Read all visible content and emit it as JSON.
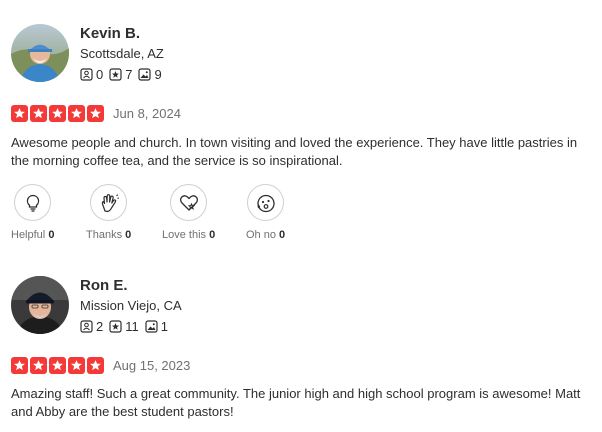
{
  "reviews": [
    {
      "name": "Kevin B.",
      "location": "Scottsdale, AZ",
      "stats": {
        "reviews": "0",
        "friends": "7",
        "photos": "9"
      },
      "rating": 5,
      "date": "Jun 8, 2024",
      "text": "Awesome people and church. In town visiting and loved the experience. They have little pastries in the morning coffee tea, and the service is so inspirational.",
      "reactions": [
        {
          "label": "Helpful",
          "count": "0",
          "icon": "lightbulb-icon"
        },
        {
          "label": "Thanks",
          "count": "0",
          "icon": "clapping-hands-icon"
        },
        {
          "label": "Love this",
          "count": "0",
          "icon": "heart-icon"
        },
        {
          "label": "Oh no",
          "count": "0",
          "icon": "surprised-face-icon"
        }
      ]
    },
    {
      "name": "Ron E.",
      "location": "Mission Viejo, CA",
      "stats": {
        "reviews": "2",
        "friends": "11",
        "photos": "1"
      },
      "rating": 5,
      "date": "Aug 15, 2023",
      "text": "Amazing staff! Such a great community. The junior high and high school program is awesome! Matt and Abby are the best student pastors!"
    }
  ],
  "colors": {
    "star_red": "#f43939",
    "text": "#2d2e2f",
    "muted": "#6e7072"
  }
}
